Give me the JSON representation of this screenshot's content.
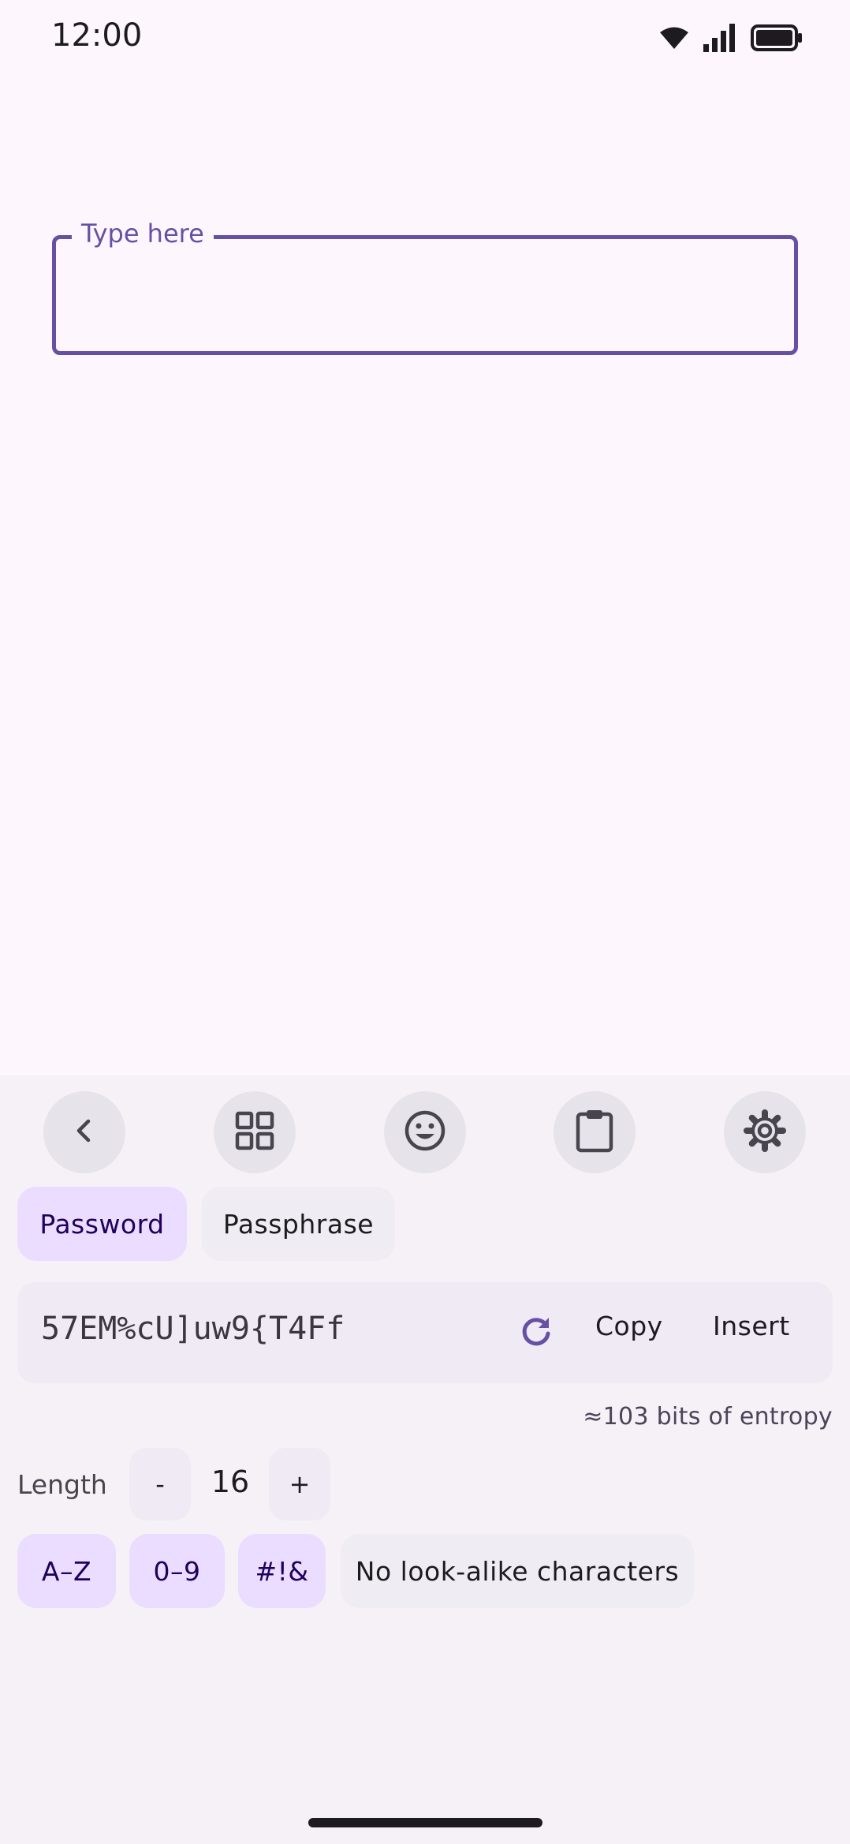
{
  "status_bar": {
    "time": "12:00",
    "icons": [
      "wifi-icon",
      "signal-icon",
      "battery-icon"
    ]
  },
  "text_field": {
    "label": "Type here",
    "value": ""
  },
  "toolbar": {
    "icons": [
      "back-icon",
      "grid-icon",
      "emoji-icon",
      "clipboard-icon",
      "settings-icon"
    ]
  },
  "mode": {
    "password_label": "Password",
    "passphrase_label": "Passphrase",
    "selected": "Password"
  },
  "generator": {
    "password": "57EM%cU]uw9{T4Ff",
    "copy_label": "Copy",
    "insert_label": "Insert",
    "entropy": "≈103 bits of entropy"
  },
  "length": {
    "label": "Length",
    "decrement_label": "-",
    "value": "16",
    "increment_label": "+"
  },
  "options": {
    "uppercase_label": "A–Z",
    "uppercase_selected": true,
    "digits_label": "0–9",
    "digits_selected": true,
    "symbols_label": "#!&",
    "symbols_selected": true,
    "no_lookalike_label": "No look-alike characters",
    "no_lookalike_selected": false
  },
  "colors": {
    "accent": "#6750a4",
    "chip_selected": "#eaddff",
    "background": "#fdf7fd",
    "panel": "#f5f1f7"
  }
}
